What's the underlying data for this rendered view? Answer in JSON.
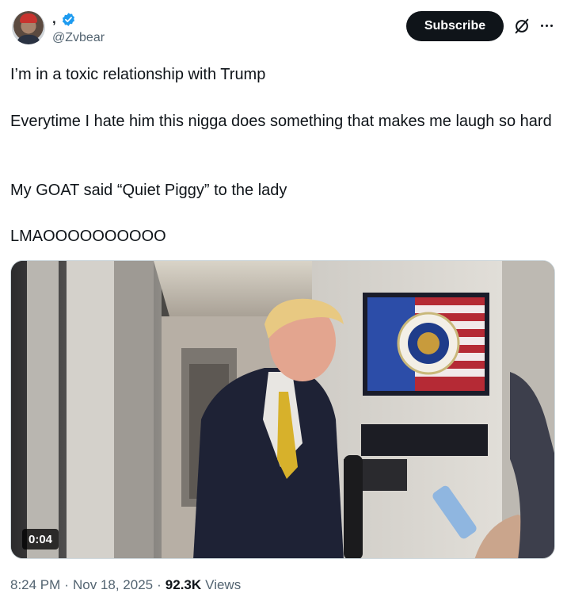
{
  "author": {
    "display_name": ",",
    "handle": "@Zvbear",
    "verified": true
  },
  "actions": {
    "subscribe_label": "Subscribe",
    "grok_icon": "slashed-circle-icon",
    "more_icon": "more-dots-icon"
  },
  "tweet": {
    "line1": "I’m in a toxic relationship with Trump",
    "line2": "Everytime I hate him this nigga does something that makes me laugh so hard",
    "line3": "My GOAT said “Quiet Piggy” to the lady",
    "line4": "LMAOOOOOOOOOO"
  },
  "media": {
    "type": "video",
    "duration": "0:04"
  },
  "meta": {
    "time": "8:24 PM",
    "separator": "·",
    "date": "Nov 18, 2025",
    "views_count": "92.3K",
    "views_label": "Views"
  },
  "colors": {
    "text": "#0f1419",
    "secondary": "#536471",
    "verified_blue": "#1d9bf0",
    "button_bg": "#0f1419"
  }
}
